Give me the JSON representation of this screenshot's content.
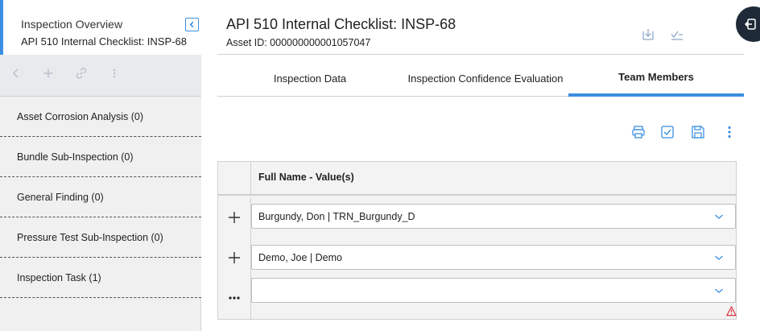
{
  "left": {
    "title": "Inspection Overview",
    "subtitle": "API 510 Internal Checklist: INSP-68",
    "nav_items": [
      {
        "label": "Asset Corrosion Analysis (0)"
      },
      {
        "label": "Bundle Sub-Inspection (0)"
      },
      {
        "label": "General Finding (0)"
      },
      {
        "label": "Pressure Test Sub-Inspection (0)"
      },
      {
        "label": "Inspection Task (1)"
      }
    ]
  },
  "header": {
    "title": "API 510 Internal Checklist: INSP-68",
    "asset_id": "Asset ID: 000000000001057047"
  },
  "tabs": [
    {
      "label": "Inspection Data",
      "active": false
    },
    {
      "label": "Inspection Confidence Evaluation",
      "active": false
    },
    {
      "label": "Team Members",
      "active": true
    }
  ],
  "grid": {
    "column_header": "Full Name - Value(s)",
    "rows": [
      {
        "value": "Burgundy, Don | TRN_Burgundy_D",
        "row_action": "plus-icon"
      },
      {
        "value": "Demo, Joe | Demo",
        "row_action": "plus-icon"
      },
      {
        "value": "",
        "row_action": "more-horizontal-icon"
      }
    ]
  },
  "colors": {
    "accent": "#3b8fe0",
    "toggle_bg": "#1f2a38",
    "warning": "#d9363e"
  }
}
